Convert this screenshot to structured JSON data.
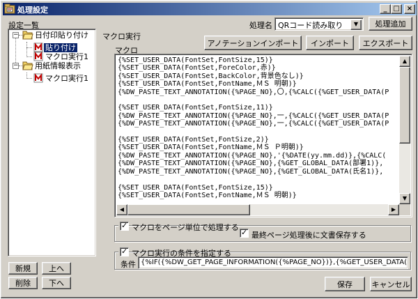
{
  "window": {
    "title": "処理設定",
    "minimize": "_",
    "maximize": "□",
    "close": "×"
  },
  "sidebar": {
    "label": "設定一覧",
    "tree": [
      {
        "label": "日付印貼り付け",
        "icon": "folder-open-icon"
      },
      {
        "label": "貼り付け",
        "icon": "macro-icon",
        "selected": true
      },
      {
        "label": "マクロ実行1",
        "icon": "macro-icon"
      },
      {
        "label": "用紙情報表示",
        "icon": "folder-open-icon"
      },
      {
        "label": "マクロ実行1",
        "icon": "macro-icon"
      }
    ],
    "buttons": {
      "new": "新規",
      "up": "上へ",
      "delete": "削除",
      "down": "下へ"
    }
  },
  "process": {
    "name_label": "処理名",
    "name_value": "QRコード読み取り",
    "add_button": "処理追加"
  },
  "macro": {
    "section_label": "マクロ実行",
    "field_label": "マクロ",
    "annotation_import_button": "アノテーションインポート",
    "import_button": "インポート",
    "export_button": "エクスポート",
    "code": "{%SET_USER_DATA(FontSet,FontSize,15)}\n{%SET_USER_DATA(FontSet,ForeColor,赤)}\n{%SET_USER_DATA(FontSet,BackColor,背景色なし)}\n{%SET_USER_DATA(FontSet,FontName,ＭＳ 明朝)}\n{%DW_PASTE_TEXT_ANNOTATION({%PAGE_NO},〇,{%CALC({%GET_USER_DATA(P\n\n{%SET_USER_DATA(FontSet,FontSize,11)}\n{%DW_PASTE_TEXT_ANNOTATION({%PAGE_NO},一,{%CALC({%GET_USER_DATA(P\n{%DW_PASTE_TEXT_ANNOTATION({%PAGE_NO},一,{%CALC({%GET_USER_DATA(P\n\n{%SET_USER_DATA(FontSet,FontSize,2)}\n{%SET_USER_DATA(FontSet,FontName,ＭＳ Ｐ明朝)}\n{%DW_PASTE_TEXT_ANNOTATION({%PAGE_NO},'{%DATE(yy.mm.dd)},{%CALC(\n{%DW_PASTE_TEXT_ANNOTATION({%PAGE_NO},{%GET_GLOBAL_DATA(部署1)},\n{%DW_PASTE_TEXT_ANNOTATION({%PAGE_NO},{%GET_GLOBAL_DATA(氏名1)},\n\n{%SET_USER_DATA(FontSet,FontSize,15)}\n{%SET_USER_DATA(FontSet,FontName,ＭＳ 明朝)}"
  },
  "options": {
    "per_page_label": "マクロをページ単位で処理する",
    "per_page_checked": true,
    "save_after_last_label": "最終ページ処理後に文書保存する",
    "save_after_last_checked": true,
    "condition_enable_label": "マクロ実行の条件を指定する",
    "condition_enable_checked": true,
    "condition_label": "条件",
    "condition_value": "{%IF({%DW_GET_PAGE_INFORMATION({%PAGE_NO})},{%GET_USER_DATA(PageInform"
  },
  "footer": {
    "save_button": "保存",
    "cancel_button": "キャンセル"
  }
}
